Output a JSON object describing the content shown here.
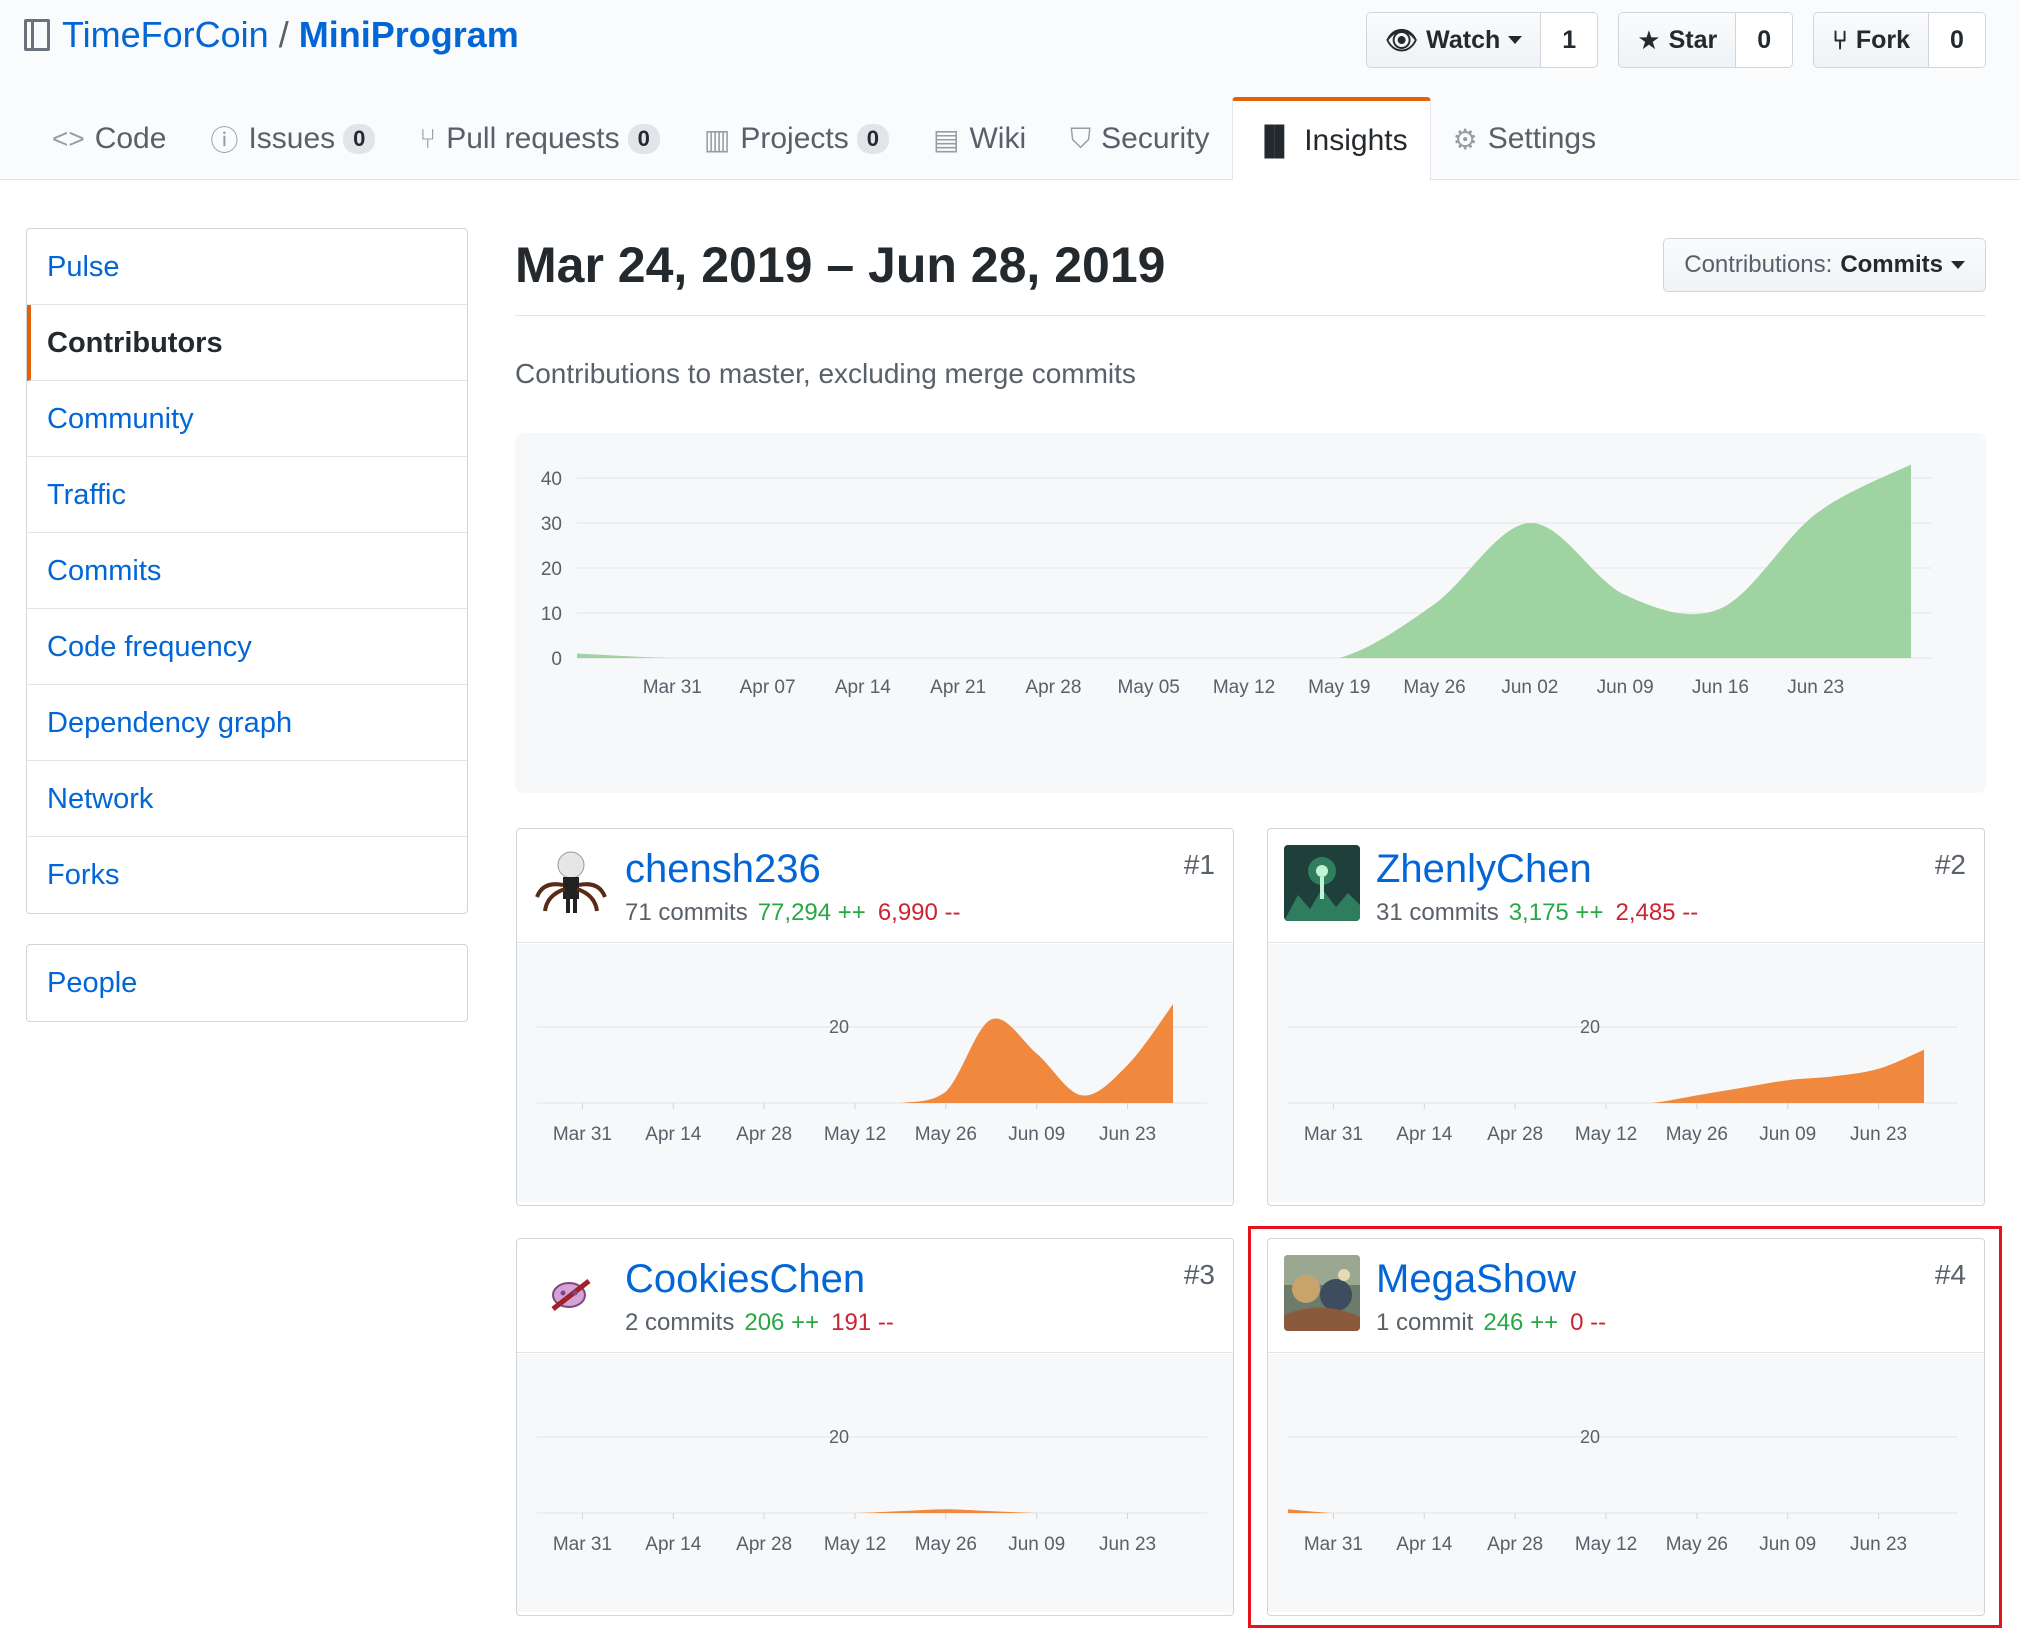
{
  "repo": {
    "owner": "TimeForCoin",
    "separator": "/",
    "name": "MiniProgram"
  },
  "actions": {
    "watch": {
      "label": "Watch",
      "count": "1"
    },
    "star": {
      "label": "Star",
      "count": "0"
    },
    "fork": {
      "label": "Fork",
      "count": "0"
    }
  },
  "tabs": [
    {
      "label": "Code",
      "icon": "code-icon",
      "glyph": "<>"
    },
    {
      "label": "Issues",
      "counter": "0",
      "icon": "issue-icon",
      "glyph": "ⓘ"
    },
    {
      "label": "Pull requests",
      "counter": "0",
      "icon": "pull-request-icon",
      "glyph": "⑂"
    },
    {
      "label": "Projects",
      "counter": "0",
      "icon": "project-icon",
      "glyph": "▥"
    },
    {
      "label": "Wiki",
      "icon": "book-icon",
      "glyph": "▤"
    },
    {
      "label": "Security",
      "icon": "shield-icon",
      "glyph": "⛉"
    },
    {
      "label": "Insights",
      "icon": "graph-icon",
      "glyph": "▐▌"
    },
    {
      "label": "Settings",
      "icon": "gear-icon",
      "glyph": "⚙"
    }
  ],
  "sidebar": {
    "items": [
      "Pulse",
      "Contributors",
      "Community",
      "Traffic",
      "Commits",
      "Code frequency",
      "Dependency graph",
      "Network",
      "Forks"
    ],
    "selected": "Contributors",
    "people": "People"
  },
  "main": {
    "date_range": "Mar 24, 2019 – Jun 28, 2019",
    "contributions_prefix": "Contributions:",
    "contributions_value": "Commits",
    "subtitle": "Contributions to master, excluding merge commits"
  },
  "colors": {
    "accent": "#e36209",
    "link": "#0366d6",
    "overview_fill": "#9fd3a1",
    "contributor_fill": "#f0893d",
    "additions": "#28a745",
    "deletions": "#cb2431",
    "highlight": "#e3141b"
  },
  "chart_data": [
    {
      "type": "area",
      "title": "",
      "x": [
        "Mar 24",
        "Mar 31",
        "Apr 07",
        "Apr 14",
        "Apr 21",
        "Apr 28",
        "May 05",
        "May 12",
        "May 19",
        "May 26",
        "Jun 02",
        "Jun 09",
        "Jun 16",
        "Jun 23",
        "Jun 28"
      ],
      "x_tick_labels": [
        "Mar 31",
        "Apr 07",
        "Apr 14",
        "Apr 21",
        "Apr 28",
        "May 05",
        "May 12",
        "May 19",
        "May 26",
        "Jun 02",
        "Jun 09",
        "Jun 16",
        "Jun 23"
      ],
      "values": [
        1,
        0,
        0,
        0,
        0,
        0,
        0,
        0,
        0,
        12,
        30,
        14,
        11,
        32,
        43
      ],
      "y_ticks": [
        0,
        10,
        20,
        30,
        40
      ],
      "ylim": [
        0,
        40
      ],
      "grid": true
    }
  ],
  "contributors": [
    {
      "login": "chensh236",
      "rank": "#1",
      "commits": "71 commits",
      "additions": "77,294 ++",
      "deletions": "6,990 --",
      "chart_data": {
        "type": "area",
        "x_tick_labels": [
          "Mar 31",
          "Apr 14",
          "Apr 28",
          "May 12",
          "May 26",
          "Jun 09",
          "Jun 23"
        ],
        "y_tick": "20",
        "ylim": [
          0,
          30
        ],
        "values": [
          0,
          0,
          0,
          0,
          0,
          0,
          0,
          0,
          0,
          3,
          22,
          13,
          2,
          10,
          26
        ]
      }
    },
    {
      "login": "ZhenlyChen",
      "rank": "#2",
      "commits": "31 commits",
      "additions": "3,175 ++",
      "deletions": "2,485 --",
      "chart_data": {
        "type": "area",
        "x_tick_labels": [
          "Mar 31",
          "Apr 14",
          "Apr 28",
          "May 12",
          "May 26",
          "Jun 09",
          "Jun 23"
        ],
        "y_tick": "20",
        "ylim": [
          0,
          30
        ],
        "values": [
          0,
          0,
          0,
          0,
          0,
          0,
          0,
          0,
          0,
          2,
          4,
          6,
          7,
          9,
          14
        ]
      }
    },
    {
      "login": "CookiesChen",
      "rank": "#3",
      "commits": "2 commits",
      "additions": "206 ++",
      "deletions": "191 --",
      "chart_data": {
        "type": "area",
        "x_tick_labels": [
          "Mar 31",
          "Apr 14",
          "Apr 28",
          "May 12",
          "May 26",
          "Jun 09",
          "Jun 23"
        ],
        "y_tick": "20",
        "ylim": [
          0,
          30
        ],
        "values": [
          0,
          0,
          0,
          0,
          0,
          0,
          0,
          0,
          0.5,
          1,
          0.5,
          0,
          0,
          0,
          0
        ]
      }
    },
    {
      "login": "MegaShow",
      "rank": "#4",
      "commits": "1 commit",
      "additions": "246 ++",
      "deletions": "0 --",
      "chart_data": {
        "type": "area",
        "x_tick_labels": [
          "Mar 31",
          "Apr 14",
          "Apr 28",
          "May 12",
          "May 26",
          "Jun 09",
          "Jun 23"
        ],
        "y_tick": "20",
        "ylim": [
          0,
          30
        ],
        "values": [
          1,
          0,
          0,
          0,
          0,
          0,
          0,
          0,
          0,
          0,
          0,
          0,
          0,
          0,
          0
        ]
      }
    }
  ]
}
